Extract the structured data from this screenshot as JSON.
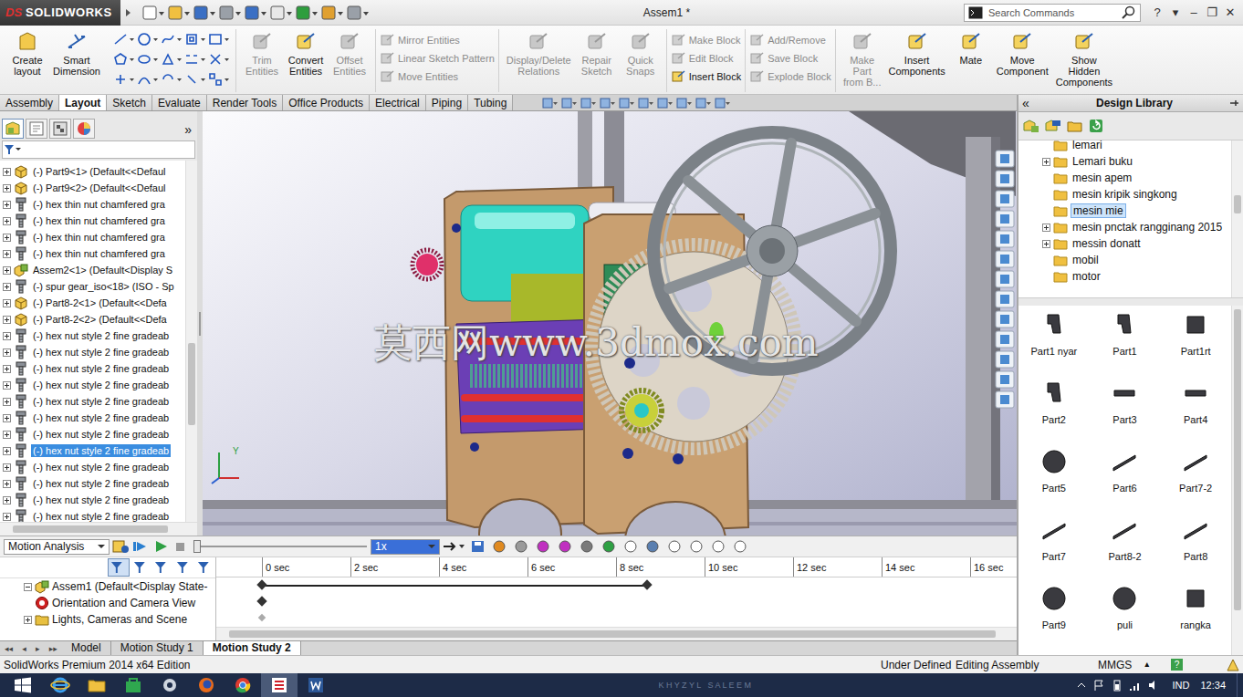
{
  "titlebar": {
    "logo_mark": "DS",
    "app": "SOLIDWORKS",
    "title": "Assem1 *",
    "search_placeholder": "Search Commands",
    "controls": [
      "?",
      "▾",
      "–",
      "❐",
      "✕"
    ]
  },
  "ribbon": {
    "lead": [
      {
        "lines": [
          "Create",
          "layout"
        ],
        "disabled": false
      },
      {
        "lines": [
          "Smart",
          "Dimension"
        ],
        "disabled": false
      }
    ],
    "groups": [
      {
        "kind": "large",
        "items": [
          {
            "lines": [
              "Trim",
              "Entities"
            ],
            "disabled": true
          },
          {
            "lines": [
              "Convert",
              "Entities"
            ],
            "disabled": false
          },
          {
            "lines": [
              "Offset",
              "Entities"
            ],
            "disabled": true
          }
        ]
      },
      {
        "kind": "small",
        "items": [
          {
            "lines": [
              "Mirror Entities"
            ],
            "disabled": true
          },
          {
            "lines": [
              "Linear Sketch Pattern"
            ],
            "disabled": true
          },
          {
            "lines": [
              "Move Entities"
            ],
            "disabled": true
          }
        ]
      },
      {
        "kind": "large",
        "items": [
          {
            "lines": [
              "Display/Delete",
              "Relations"
            ],
            "disabled": true
          },
          {
            "lines": [
              "Repair",
              "Sketch"
            ],
            "disabled": true
          },
          {
            "lines": [
              "Quick",
              "Snaps"
            ],
            "disabled": true
          }
        ]
      },
      {
        "kind": "small",
        "items": [
          {
            "lines": [
              "Make Block"
            ],
            "disabled": true
          },
          {
            "lines": [
              "Edit Block"
            ],
            "disabled": true
          },
          {
            "lines": [
              "Insert Block"
            ],
            "disabled": false
          }
        ]
      },
      {
        "kind": "small",
        "items": [
          {
            "lines": [
              "Add/Remove"
            ],
            "disabled": true
          },
          {
            "lines": [
              "Save Block"
            ],
            "disabled": true
          },
          {
            "lines": [
              "Explode Block"
            ],
            "disabled": true
          }
        ]
      },
      {
        "kind": "large",
        "items": [
          {
            "lines": [
              "Make",
              "Part",
              "from B..."
            ],
            "disabled": true
          },
          {
            "lines": [
              "Insert",
              "Components"
            ],
            "disabled": false
          },
          {
            "lines": [
              "Mate"
            ],
            "disabled": false
          },
          {
            "lines": [
              "Move",
              "Component"
            ],
            "disabled": false
          },
          {
            "lines": [
              "Show",
              "Hidden",
              "Components"
            ],
            "disabled": false
          }
        ]
      }
    ]
  },
  "command_tabs": [
    {
      "label": "Assembly",
      "selected": false
    },
    {
      "label": "Layout",
      "selected": true
    },
    {
      "label": "Sketch",
      "selected": false
    },
    {
      "label": "Evaluate",
      "selected": false
    },
    {
      "label": "Render Tools",
      "selected": false
    },
    {
      "label": "Office Products",
      "selected": false
    },
    {
      "label": "Electrical",
      "selected": false
    },
    {
      "label": "Piping",
      "selected": false
    },
    {
      "label": "Tubing",
      "selected": false
    }
  ],
  "feature_tree": {
    "expand": "»",
    "items": [
      {
        "text": "(-) Part9<1> (Default<<Defaul",
        "kind": "part",
        "selected": false
      },
      {
        "text": "(-) Part9<2> (Default<<Defaul",
        "kind": "part",
        "selected": false
      },
      {
        "text": "(-) hex thin nut chamfered gra",
        "kind": "fastener",
        "selected": false
      },
      {
        "text": "(-) hex thin nut chamfered gra",
        "kind": "fastener",
        "selected": false
      },
      {
        "text": "(-) hex thin nut chamfered gra",
        "kind": "fastener",
        "selected": false
      },
      {
        "text": "(-) hex thin nut chamfered gra",
        "kind": "fastener",
        "selected": false
      },
      {
        "text": "Assem2<1> (Default<Display S",
        "kind": "assembly",
        "selected": false
      },
      {
        "text": "(-) spur gear_iso<18> (ISO - Sp",
        "kind": "fastener",
        "selected": false
      },
      {
        "text": "(-) Part8-2<1> (Default<<Defa",
        "kind": "part",
        "selected": false
      },
      {
        "text": "(-) Part8-2<2> (Default<<Defa",
        "kind": "part",
        "selected": false
      },
      {
        "text": "(-) hex nut style 2 fine gradeab",
        "kind": "fastener",
        "selected": false
      },
      {
        "text": "(-) hex nut style 2 fine gradeab",
        "kind": "fastener",
        "selected": false
      },
      {
        "text": "(-) hex nut style 2 fine gradeab",
        "kind": "fastener",
        "selected": false
      },
      {
        "text": "(-) hex nut style 2 fine gradeab",
        "kind": "fastener",
        "selected": false
      },
      {
        "text": "(-) hex nut style 2 fine gradeab",
        "kind": "fastener",
        "selected": false
      },
      {
        "text": "(-) hex nut style 2 fine gradeab",
        "kind": "fastener",
        "selected": false
      },
      {
        "text": "(-) hex nut style 2 fine gradeab",
        "kind": "fastener",
        "selected": false
      },
      {
        "text": "(-) hex nut style 2 fine gradeab",
        "kind": "fastener",
        "selected": true
      },
      {
        "text": "(-) hex nut style 2 fine gradeab",
        "kind": "fastener",
        "selected": false
      },
      {
        "text": "(-) hex nut style 2 fine gradeab",
        "kind": "fastener",
        "selected": false
      },
      {
        "text": "(-) hex nut style 2 fine gradeab",
        "kind": "fastener",
        "selected": false
      },
      {
        "text": "(-) hex nut style 2 fine gradeab",
        "kind": "fastener",
        "selected": false
      }
    ]
  },
  "viewport": {
    "watermark": "莫西网www.3dmox.com",
    "triad_label": "Y"
  },
  "design_library": {
    "title": "Design Library",
    "collapse": "«",
    "folders": [
      {
        "name": "lemari",
        "expandable": false,
        "selected": false
      },
      {
        "name": "Lemari buku",
        "expandable": true,
        "selected": false
      },
      {
        "name": "mesin apem",
        "expandable": false,
        "selected": false
      },
      {
        "name": "mesin kripik singkong",
        "expandable": false,
        "selected": false
      },
      {
        "name": "mesin mie",
        "expandable": false,
        "selected": true
      },
      {
        "name": "mesin pnctak rangginang 2015",
        "expandable": true,
        "selected": false
      },
      {
        "name": "messin donatt",
        "expandable": true,
        "selected": false
      },
      {
        "name": "mobil",
        "expandable": false,
        "selected": false
      },
      {
        "name": "motor",
        "expandable": false,
        "selected": false
      }
    ],
    "parts": [
      "Part1 nyar",
      "Part1",
      "Part1rt",
      "Part2",
      "Part3",
      "Part4",
      "Part5",
      "Part6",
      "Part7-2",
      "Part7",
      "Part8-2",
      "Part8",
      "Part9",
      "puli",
      "rangka"
    ]
  },
  "motion": {
    "study_type": "Motion Analysis",
    "speed": "1x",
    "playback_level": 0,
    "ticks": [
      "0 sec",
      "2 sec",
      "4 sec",
      "6 sec",
      "8 sec",
      "10 sec",
      "12 sec",
      "14 sec",
      "16 sec"
    ],
    "tree": [
      {
        "text": "Assem1  (Default<Display State-",
        "kind": "assembly",
        "expandable": true,
        "expanded": true,
        "keys": [
          0,
          8.7
        ],
        "span": true
      },
      {
        "text": "Orientation and Camera View",
        "kind": "camera",
        "expandable": false,
        "expanded": false,
        "keys": [
          0
        ],
        "span": false
      },
      {
        "text": "Lights, Cameras and Scene",
        "kind": "lights",
        "expandable": true,
        "expanded": false,
        "keys": [
          0
        ],
        "span": false
      }
    ]
  },
  "sheet_nav": [
    "◂◂",
    "◂",
    "▸",
    "▸▸"
  ],
  "sheet_tabs": [
    {
      "label": "Model",
      "selected": false
    },
    {
      "label": "Motion Study 1",
      "selected": false
    },
    {
      "label": "Motion Study 2",
      "selected": true
    }
  ],
  "status_bar": {
    "edition": "SolidWorks Premium 2014 x64 Edition",
    "definition": "Under Defined",
    "mode": "Editing Assembly",
    "units": "MMGS",
    "units_arrow": "▴",
    "help": "?"
  },
  "taskbar": {
    "user": "K H Y Z Y L   S A L E E M",
    "language": "IND",
    "time": "12:34",
    "apps": [
      {
        "kind": "ie",
        "active": false
      },
      {
        "kind": "explorer",
        "active": false
      },
      {
        "kind": "store",
        "active": false
      },
      {
        "kind": "settings",
        "active": false
      },
      {
        "kind": "firefox",
        "active": false
      },
      {
        "kind": "chrome",
        "active": false
      },
      {
        "kind": "solidworks",
        "active": true
      },
      {
        "kind": "word",
        "active": false
      }
    ]
  }
}
